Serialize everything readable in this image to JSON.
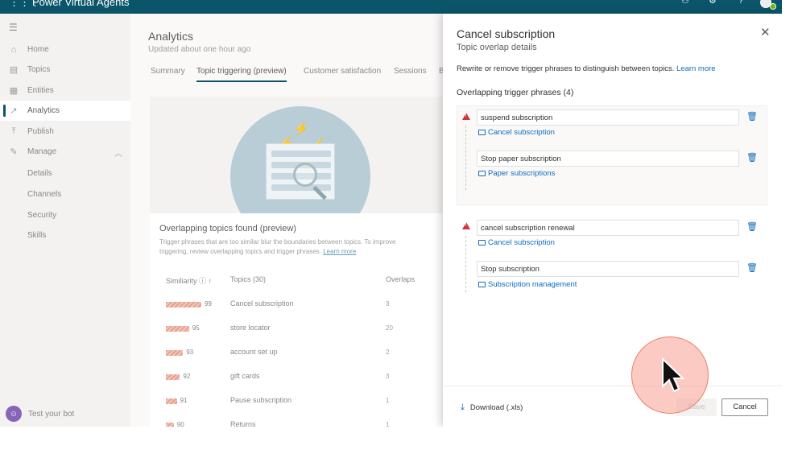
{
  "topbar": {
    "app_name": "Power Virtual Agents",
    "waffle_icon": "waffle-icon",
    "icons": [
      "bot-icon",
      "settings-icon",
      "help-icon"
    ]
  },
  "sidebar": {
    "items": [
      {
        "label": "Home",
        "icon": "home-icon"
      },
      {
        "label": "Topics",
        "icon": "topics-icon"
      },
      {
        "label": "Entities",
        "icon": "entities-icon"
      },
      {
        "label": "Analytics",
        "icon": "analytics-icon",
        "active": true
      },
      {
        "label": "Publish",
        "icon": "publish-icon"
      },
      {
        "label": "Manage",
        "icon": "manage-icon",
        "expanded": true
      }
    ],
    "sub_items": [
      "Details",
      "Channels",
      "Security",
      "Skills"
    ],
    "test_bot": "Test your bot"
  },
  "analytics": {
    "title": "Analytics",
    "updated": "Updated about one hour ago",
    "tabs": [
      "Summary",
      "Topic triggering (preview)",
      "Customer satisfaction",
      "Sessions",
      "B"
    ],
    "active_tab": "Topic triggering (preview)",
    "overlap_title": "Overlapping topics found (preview)",
    "overlap_desc": "Trigger phrases that are too similar blur the boundaries between topics. To improve triggering, review overlapping topics and trigger phrases.",
    "overlap_link": "Learn more",
    "columns": {
      "similarity": "Similiarity",
      "topics": "Topics (30)",
      "overlaps": "Overlaps"
    },
    "rows": [
      {
        "similarity": 99,
        "topic": "Cancel subscription",
        "overlaps": "3"
      },
      {
        "similarity": 95,
        "topic": "store locator",
        "overlaps": "20"
      },
      {
        "similarity": 93,
        "topic": "account set up",
        "overlaps": "2"
      },
      {
        "similarity": 92,
        "topic": "gift cards",
        "overlaps": "3"
      },
      {
        "similarity": 91,
        "topic": "Pause subscription",
        "overlaps": "1"
      },
      {
        "similarity": 90,
        "topic": "Returns",
        "overlaps": "1"
      }
    ]
  },
  "panel": {
    "title": "Cancel subscription",
    "subtitle": "Topic overlap details",
    "description": "Rewrite or remove trigger phrases to distinguish between topics.",
    "learn_more": "Learn more",
    "section_title": "Overlapping trigger phrases (4)",
    "groups": [
      {
        "phrases": [
          {
            "text": "suspend subscription",
            "topic": "Cancel subscription"
          },
          {
            "text": "Stop paper subscription",
            "topic": "Paper subscriptions"
          }
        ]
      },
      {
        "phrases": [
          {
            "text": "cancel subscription renewal",
            "topic": "Cancel subscription"
          },
          {
            "text": "Stop subscription",
            "topic": "Subscription management"
          }
        ]
      }
    ],
    "download": "Download (.xls)",
    "save": "Save",
    "cancel": "Cancel"
  }
}
